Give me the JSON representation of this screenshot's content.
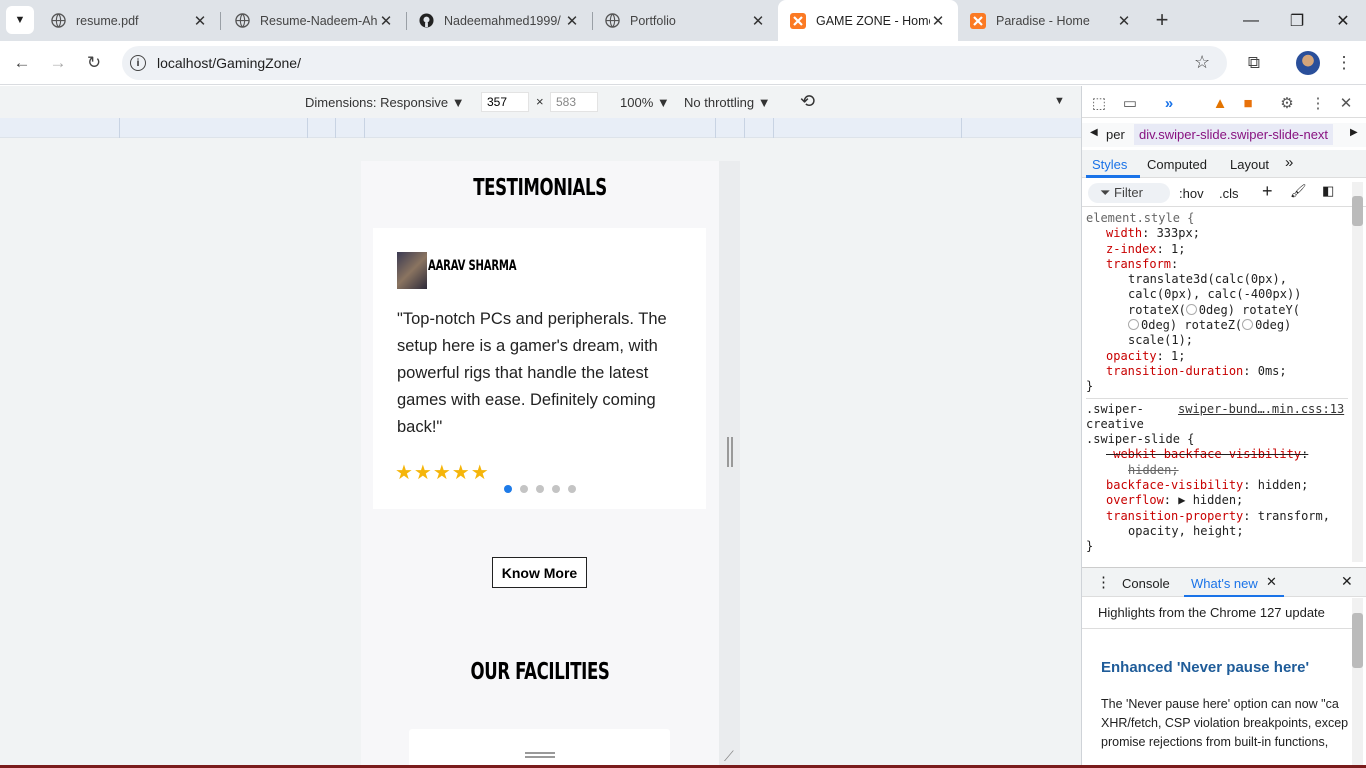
{
  "tabs": [
    {
      "title": "resume.pdf",
      "icon": "globe-icon"
    },
    {
      "title": "Resume-Nadeem-Ah",
      "icon": "globe-icon"
    },
    {
      "title": "Nadeemahmed1999/",
      "icon": "github-icon"
    },
    {
      "title": "Portfolio",
      "icon": "globe-icon"
    },
    {
      "title": "GAME ZONE - Home",
      "icon": "xampp-icon",
      "active": true
    },
    {
      "title": "Paradise - Home",
      "icon": "xampp-icon"
    }
  ],
  "address": {
    "url": "localhost/GamingZone/"
  },
  "emulation": {
    "dimensions": "Dimensions: Responsive",
    "width": "357",
    "height": "583",
    "times": "×",
    "zoom": "100%",
    "throttle": "No throttling"
  },
  "page": {
    "testimonials_title": "TESTIMONIALS",
    "author": "AARAV SHARMA",
    "quote": "\"Top-notch PCs and peripherals. The setup here is a gamer's dream, with powerful rigs that handle the latest games with ease. Definitely coming back!\"",
    "stars": "★★★★★",
    "rating_stars": 5,
    "active_dot": 1,
    "dot_count": 5,
    "know_more": "Know More",
    "facilities_title": "OUR FACILITIES"
  },
  "devtools": {
    "breadcrumb_prev": "per",
    "breadcrumb": "div.swiper-slide.swiper-slide-next",
    "tabs": [
      "Styles",
      "Computed",
      "Layout"
    ],
    "filter": "Filter",
    "hov": ":hov",
    "cls": ".cls",
    "rule1": {
      "selector": "element.style {",
      "lines": [
        {
          "p": "width",
          "v": "333px;"
        },
        {
          "p": "z-index",
          "v": "1;"
        },
        {
          "p": "transform",
          "v": ""
        }
      ],
      "transform_lines": [
        "translate3d(calc(0px),",
        "calc(0px), calc(-400px))",
        "0deg) rotateY(",
        "0deg) rotateZ(",
        "0deg)",
        "scale(1);"
      ],
      "rotatex": "rotateX(",
      "opacity": {
        "p": "opacity",
        "v": "1;"
      },
      "duration": {
        "p": "transition-duration",
        "v": "0ms;"
      },
      "close": "}"
    },
    "rule2": {
      "sel1": ".swiper-",
      "sel2": "creative",
      "sel3": ".swiper-slide {",
      "source": "swiper-bund….min.css:13",
      "webkit_p": "-webkit-backface-visibility",
      "webkit_v": "hidden;",
      "bv_p": "backface-visibility",
      "bv_v": "hidden;",
      "ov_p": "overflow",
      "ov_v": "hidden;",
      "tp_p": "transition-property",
      "tp_v": "transform,",
      "tp_v2": "opacity, height;",
      "close": "}"
    },
    "drawer": {
      "tabs": [
        "Console",
        "What's new"
      ],
      "highlights": "Highlights from the Chrome 127 update",
      "heading": "Enhanced 'Never pause here'",
      "body": [
        "The 'Never pause here' option can now \"ca",
        "XHR/fetch, CSP violation breakpoints, excep",
        "promise rejections from built-in functions,"
      ]
    }
  }
}
